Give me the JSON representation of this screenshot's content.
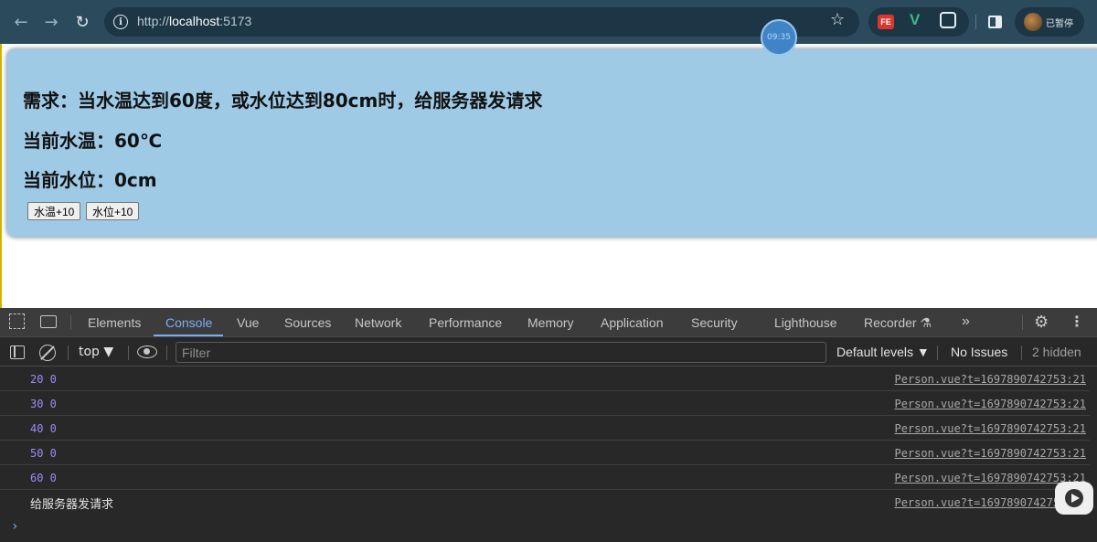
{
  "browser": {
    "url_scheme": "http://",
    "url_host": "localhost",
    "url_port": ":5173",
    "profile_label": "已暂停",
    "extensions": [
      "FE",
      "V"
    ],
    "recording_timer": "09:35",
    "icons": [
      "back-icon",
      "forward-icon",
      "reload-icon",
      "site-info-icon",
      "bookmark-star-icon",
      "extensions-puzzle-icon",
      "side-panel-icon"
    ]
  },
  "page": {
    "requirement": "需求：当水温达到60度，或水位达到80cm时，给服务器发请求",
    "temp_text": "当前水温：60℃",
    "level_text": "当前水位：0cm",
    "buttons": {
      "temp_button": "水温+10",
      "level_button": "水位+10"
    },
    "colors": {
      "card_bg": "#9ecae6"
    }
  },
  "devtools": {
    "tabs": [
      "Elements",
      "Console",
      "Vue",
      "Sources",
      "Network",
      "Performance",
      "Memory",
      "Application",
      "Security",
      "Lighthouse",
      "Recorder ⚗"
    ],
    "active_tab": "Console",
    "more_tabs": "»",
    "context": "top ▼",
    "filter_placeholder": "Filter",
    "levels": "Default levels ▼",
    "issues": "No Issues",
    "hidden_count": "2 hidden",
    "messages": [
      {
        "text": "20 0",
        "source": "Person.vue?t=1697890742753:21"
      },
      {
        "text": "30 0",
        "source": "Person.vue?t=1697890742753:21"
      },
      {
        "text": "40 0",
        "source": "Person.vue?t=1697890742753:21"
      },
      {
        "text": "50 0",
        "source": "Person.vue?t=1697890742753:21"
      },
      {
        "text": "60 0",
        "source": "Person.vue?t=1697890742753:21"
      },
      {
        "text": "给服务器发请求",
        "source": "Person.vue?t=1697890742753:21"
      }
    ],
    "prompt_symbol": "›",
    "colors": {
      "active_tab": "#7cacf8",
      "log_number": "#9a8cf3"
    }
  }
}
